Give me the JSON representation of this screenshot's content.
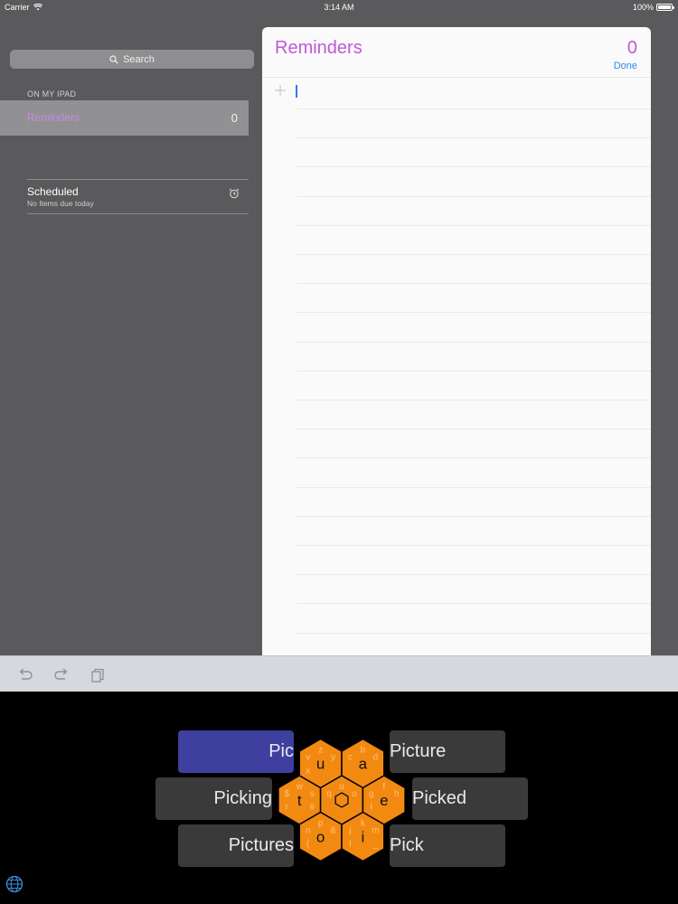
{
  "status_bar": {
    "carrier": "Carrier",
    "time": "3:14 AM",
    "battery": "100%"
  },
  "sidebar": {
    "search_placeholder": "Search",
    "section_header": "ON MY IPAD",
    "lists": [
      {
        "name": "Reminders",
        "count": "0"
      }
    ],
    "scheduled": {
      "title": "Scheduled",
      "subtitle": "No Items due today",
      "icon": "alarm-clock-icon"
    }
  },
  "main": {
    "title": "Reminders",
    "count": "0",
    "done_label": "Done",
    "add_icon": "plus-icon"
  },
  "toolbar": {
    "icons": [
      "undo-icon",
      "redo-icon",
      "paste-icon"
    ]
  },
  "keyboard": {
    "suggestions": {
      "left": [
        "Pic",
        "Picking",
        "Pictures"
      ],
      "right": [
        "Picture",
        "Picked",
        "Pick"
      ],
      "selected": "Pic"
    },
    "hexes": [
      {
        "main": "u",
        "small": [
          "z",
          "v",
          "y",
          "x"
        ]
      },
      {
        "main": "a",
        "small": [
          "b",
          "c",
          "d"
        ]
      },
      {
        "main": "t",
        "small": [
          "w",
          "$",
          "s",
          "r",
          "#"
        ]
      },
      {
        "main": "",
        "small": [
          "u",
          "q",
          "o"
        ]
      },
      {
        "main": "e",
        "small": [
          "f",
          "g",
          "h",
          "l"
        ]
      },
      {
        "main": "o",
        "small": [
          "p",
          "n",
          "&",
          "("
        ]
      },
      {
        "main": "i",
        "small": [
          "k",
          "j",
          "m",
          "l",
          "_"
        ]
      }
    ],
    "center_icon": "hexagon-icon",
    "globe_icon": "globe-icon"
  },
  "colors": {
    "accent": "#c058d8",
    "done": "#2a8cf0",
    "hex": "#f28a12",
    "selected_suggestion": "#3f3fa0"
  }
}
